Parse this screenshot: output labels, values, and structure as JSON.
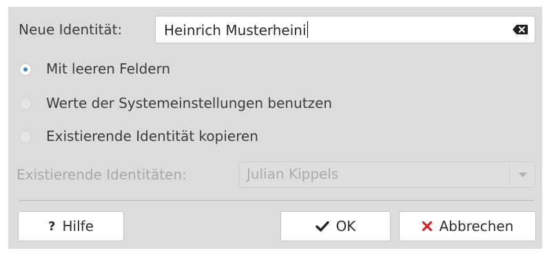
{
  "dialog": {
    "name_label": "Neue Identität:",
    "name_value": "Heinrich Musterheini",
    "options": [
      {
        "label": "Mit leeren Feldern",
        "checked": true,
        "enabled": true
      },
      {
        "label": "Werte der Systemeinstellungen benutzen",
        "checked": false,
        "enabled": true
      },
      {
        "label": "Existierende Identität kopieren",
        "checked": false,
        "enabled": true
      }
    ],
    "existing_label": "Existierende Identitäten:",
    "existing_value": "Julian Kippels",
    "help_label": "Hilfe",
    "ok_label": "OK",
    "cancel_label": "Abbrechen"
  },
  "icons": {
    "clear": "backspace-clear-icon",
    "help": "question-mark-icon",
    "ok": "checkmark-icon",
    "cancel": "x-icon",
    "dropdown": "chevron-down-icon"
  },
  "colors": {
    "dialog_bg": "#dcdcdc",
    "radio_accent": "#3a82d6",
    "cancel_icon": "#e01b1b",
    "disabled_text": "#a8a8a8"
  }
}
